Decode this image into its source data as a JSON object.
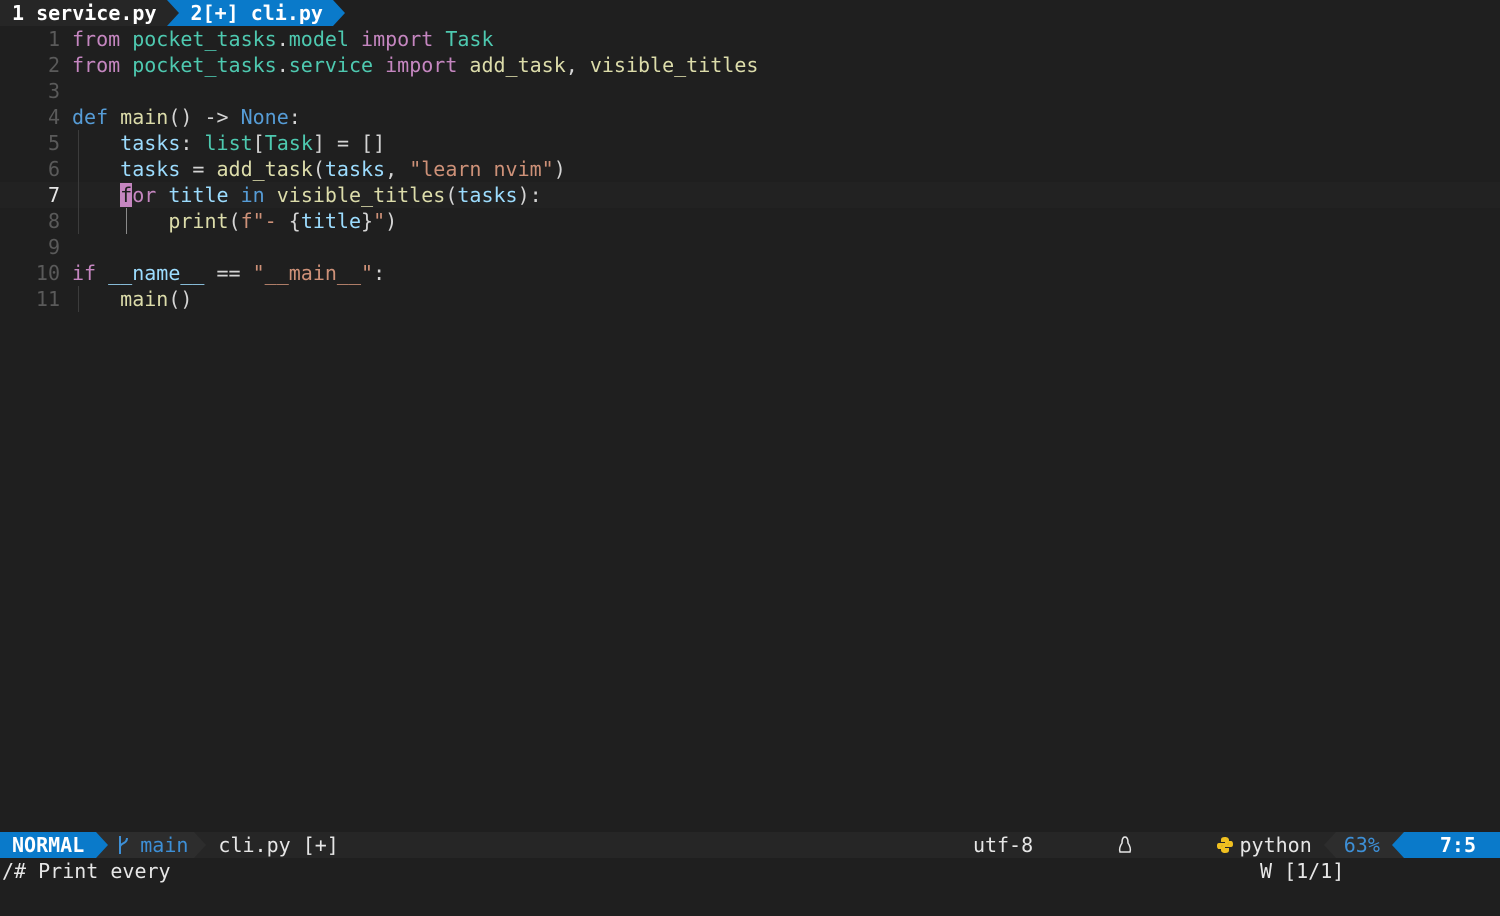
{
  "tabs": [
    {
      "label": "1 service.py",
      "active": false
    },
    {
      "label": "2[+] cli.py",
      "active": true
    }
  ],
  "code": {
    "lines": [
      {
        "n": "1",
        "tokens": [
          [
            "kw",
            "from"
          ],
          [
            "pl",
            " "
          ],
          [
            "mod",
            "pocket_tasks"
          ],
          [
            "pl",
            "."
          ],
          [
            "mod",
            "model"
          ],
          [
            "pl",
            " "
          ],
          [
            "kw",
            "import"
          ],
          [
            "pl",
            " "
          ],
          [
            "typ",
            "Task"
          ]
        ]
      },
      {
        "n": "2",
        "tokens": [
          [
            "kw",
            "from"
          ],
          [
            "pl",
            " "
          ],
          [
            "mod",
            "pocket_tasks"
          ],
          [
            "pl",
            "."
          ],
          [
            "mod",
            "service"
          ],
          [
            "pl",
            " "
          ],
          [
            "kw",
            "import"
          ],
          [
            "pl",
            " "
          ],
          [
            "fn",
            "add_task"
          ],
          [
            "pl",
            ", "
          ],
          [
            "fn",
            "visible_titles"
          ]
        ]
      },
      {
        "n": "3",
        "tokens": []
      },
      {
        "n": "4",
        "tokens": [
          [
            "kw2",
            "def"
          ],
          [
            "pl",
            " "
          ],
          [
            "fn",
            "main"
          ],
          [
            "pl",
            "() -> "
          ],
          [
            "kw2",
            "None"
          ],
          [
            "pl",
            ":"
          ]
        ]
      },
      {
        "n": "5",
        "tokens": [
          [
            "pl",
            "    "
          ],
          [
            "var",
            "tasks"
          ],
          [
            "pl",
            ": "
          ],
          [
            "typ",
            "list"
          ],
          [
            "pl",
            "["
          ],
          [
            "typ",
            "Task"
          ],
          [
            "pl",
            "] = []"
          ]
        ]
      },
      {
        "n": "6",
        "tokens": [
          [
            "pl",
            "    "
          ],
          [
            "var",
            "tasks"
          ],
          [
            "pl",
            " = "
          ],
          [
            "fn",
            "add_task"
          ],
          [
            "pl",
            "("
          ],
          [
            "var",
            "tasks"
          ],
          [
            "pl",
            ", "
          ],
          [
            "str",
            "\"learn nvim\""
          ],
          [
            "pl",
            ")"
          ]
        ]
      },
      {
        "n": "7",
        "tokens": [
          [
            "pl",
            "    "
          ],
          [
            "cursor",
            "f"
          ],
          [
            "kw",
            "or"
          ],
          [
            "pl",
            " "
          ],
          [
            "var",
            "title"
          ],
          [
            "pl",
            " "
          ],
          [
            "kw2",
            "in"
          ],
          [
            "pl",
            " "
          ],
          [
            "fn",
            "visible_titles"
          ],
          [
            "pl",
            "("
          ],
          [
            "var",
            "tasks"
          ],
          [
            "pl",
            "):"
          ]
        ]
      },
      {
        "n": "8",
        "tokens": [
          [
            "pl",
            "        "
          ],
          [
            "fn",
            "print"
          ],
          [
            "pl",
            "("
          ],
          [
            "str",
            "f\"- "
          ],
          [
            "pl",
            "{"
          ],
          [
            "var",
            "title"
          ],
          [
            "pl",
            "}"
          ],
          [
            "str",
            "\""
          ],
          [
            "pl",
            ")"
          ]
        ]
      },
      {
        "n": "9",
        "tokens": []
      },
      {
        "n": "10",
        "tokens": [
          [
            "kw",
            "if"
          ],
          [
            "pl",
            " "
          ],
          [
            "var",
            "__name__"
          ],
          [
            "pl",
            " == "
          ],
          [
            "str",
            "\"__main__\""
          ],
          [
            "pl",
            ":"
          ]
        ]
      },
      {
        "n": "11",
        "tokens": [
          [
            "pl",
            "    "
          ],
          [
            "fn",
            "main"
          ],
          [
            "pl",
            "()"
          ]
        ]
      }
    ],
    "current_line": "7"
  },
  "statusline": {
    "mode": "NORMAL",
    "branch_icon": "git-branch-icon",
    "branch": "main",
    "file": "cli.py [+]",
    "encoding": "utf-8",
    "os_icon": "linux-icon",
    "filetype_icon": "python-icon",
    "filetype": "python",
    "percent": "63%",
    "position": "7:5",
    "colors": {
      "accent": "#0a7aca",
      "branch": "#3d8fd6"
    }
  },
  "cmdline": {
    "left": "/# Print every",
    "right": "W [1/1]"
  }
}
